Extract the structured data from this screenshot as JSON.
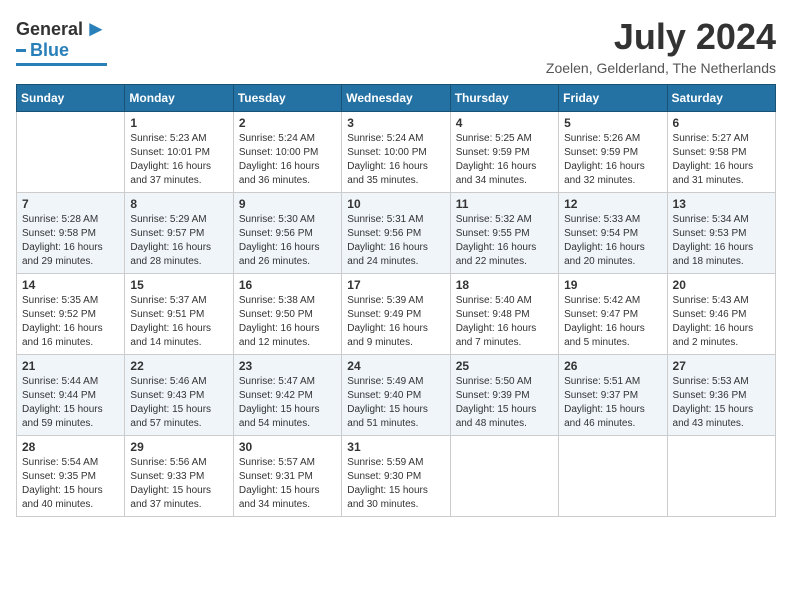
{
  "logo": {
    "general": "General",
    "blue": "Blue",
    "tagline": ""
  },
  "title": "July 2024",
  "location": "Zoelen, Gelderland, The Netherlands",
  "weekdays": [
    "Sunday",
    "Monday",
    "Tuesday",
    "Wednesday",
    "Thursday",
    "Friday",
    "Saturday"
  ],
  "weeks": [
    [
      {
        "day": "",
        "sunrise": "",
        "sunset": "",
        "daylight": ""
      },
      {
        "day": "1",
        "sunrise": "Sunrise: 5:23 AM",
        "sunset": "Sunset: 10:01 PM",
        "daylight": "Daylight: 16 hours and 37 minutes."
      },
      {
        "day": "2",
        "sunrise": "Sunrise: 5:24 AM",
        "sunset": "Sunset: 10:00 PM",
        "daylight": "Daylight: 16 hours and 36 minutes."
      },
      {
        "day": "3",
        "sunrise": "Sunrise: 5:24 AM",
        "sunset": "Sunset: 10:00 PM",
        "daylight": "Daylight: 16 hours and 35 minutes."
      },
      {
        "day": "4",
        "sunrise": "Sunrise: 5:25 AM",
        "sunset": "Sunset: 9:59 PM",
        "daylight": "Daylight: 16 hours and 34 minutes."
      },
      {
        "day": "5",
        "sunrise": "Sunrise: 5:26 AM",
        "sunset": "Sunset: 9:59 PM",
        "daylight": "Daylight: 16 hours and 32 minutes."
      },
      {
        "day": "6",
        "sunrise": "Sunrise: 5:27 AM",
        "sunset": "Sunset: 9:58 PM",
        "daylight": "Daylight: 16 hours and 31 minutes."
      }
    ],
    [
      {
        "day": "7",
        "sunrise": "Sunrise: 5:28 AM",
        "sunset": "Sunset: 9:58 PM",
        "daylight": "Daylight: 16 hours and 29 minutes."
      },
      {
        "day": "8",
        "sunrise": "Sunrise: 5:29 AM",
        "sunset": "Sunset: 9:57 PM",
        "daylight": "Daylight: 16 hours and 28 minutes."
      },
      {
        "day": "9",
        "sunrise": "Sunrise: 5:30 AM",
        "sunset": "Sunset: 9:56 PM",
        "daylight": "Daylight: 16 hours and 26 minutes."
      },
      {
        "day": "10",
        "sunrise": "Sunrise: 5:31 AM",
        "sunset": "Sunset: 9:56 PM",
        "daylight": "Daylight: 16 hours and 24 minutes."
      },
      {
        "day": "11",
        "sunrise": "Sunrise: 5:32 AM",
        "sunset": "Sunset: 9:55 PM",
        "daylight": "Daylight: 16 hours and 22 minutes."
      },
      {
        "day": "12",
        "sunrise": "Sunrise: 5:33 AM",
        "sunset": "Sunset: 9:54 PM",
        "daylight": "Daylight: 16 hours and 20 minutes."
      },
      {
        "day": "13",
        "sunrise": "Sunrise: 5:34 AM",
        "sunset": "Sunset: 9:53 PM",
        "daylight": "Daylight: 16 hours and 18 minutes."
      }
    ],
    [
      {
        "day": "14",
        "sunrise": "Sunrise: 5:35 AM",
        "sunset": "Sunset: 9:52 PM",
        "daylight": "Daylight: 16 hours and 16 minutes."
      },
      {
        "day": "15",
        "sunrise": "Sunrise: 5:37 AM",
        "sunset": "Sunset: 9:51 PM",
        "daylight": "Daylight: 16 hours and 14 minutes."
      },
      {
        "day": "16",
        "sunrise": "Sunrise: 5:38 AM",
        "sunset": "Sunset: 9:50 PM",
        "daylight": "Daylight: 16 hours and 12 minutes."
      },
      {
        "day": "17",
        "sunrise": "Sunrise: 5:39 AM",
        "sunset": "Sunset: 9:49 PM",
        "daylight": "Daylight: 16 hours and 9 minutes."
      },
      {
        "day": "18",
        "sunrise": "Sunrise: 5:40 AM",
        "sunset": "Sunset: 9:48 PM",
        "daylight": "Daylight: 16 hours and 7 minutes."
      },
      {
        "day": "19",
        "sunrise": "Sunrise: 5:42 AM",
        "sunset": "Sunset: 9:47 PM",
        "daylight": "Daylight: 16 hours and 5 minutes."
      },
      {
        "day": "20",
        "sunrise": "Sunrise: 5:43 AM",
        "sunset": "Sunset: 9:46 PM",
        "daylight": "Daylight: 16 hours and 2 minutes."
      }
    ],
    [
      {
        "day": "21",
        "sunrise": "Sunrise: 5:44 AM",
        "sunset": "Sunset: 9:44 PM",
        "daylight": "Daylight: 15 hours and 59 minutes."
      },
      {
        "day": "22",
        "sunrise": "Sunrise: 5:46 AM",
        "sunset": "Sunset: 9:43 PM",
        "daylight": "Daylight: 15 hours and 57 minutes."
      },
      {
        "day": "23",
        "sunrise": "Sunrise: 5:47 AM",
        "sunset": "Sunset: 9:42 PM",
        "daylight": "Daylight: 15 hours and 54 minutes."
      },
      {
        "day": "24",
        "sunrise": "Sunrise: 5:49 AM",
        "sunset": "Sunset: 9:40 PM",
        "daylight": "Daylight: 15 hours and 51 minutes."
      },
      {
        "day": "25",
        "sunrise": "Sunrise: 5:50 AM",
        "sunset": "Sunset: 9:39 PM",
        "daylight": "Daylight: 15 hours and 48 minutes."
      },
      {
        "day": "26",
        "sunrise": "Sunrise: 5:51 AM",
        "sunset": "Sunset: 9:37 PM",
        "daylight": "Daylight: 15 hours and 46 minutes."
      },
      {
        "day": "27",
        "sunrise": "Sunrise: 5:53 AM",
        "sunset": "Sunset: 9:36 PM",
        "daylight": "Daylight: 15 hours and 43 minutes."
      }
    ],
    [
      {
        "day": "28",
        "sunrise": "Sunrise: 5:54 AM",
        "sunset": "Sunset: 9:35 PM",
        "daylight": "Daylight: 15 hours and 40 minutes."
      },
      {
        "day": "29",
        "sunrise": "Sunrise: 5:56 AM",
        "sunset": "Sunset: 9:33 PM",
        "daylight": "Daylight: 15 hours and 37 minutes."
      },
      {
        "day": "30",
        "sunrise": "Sunrise: 5:57 AM",
        "sunset": "Sunset: 9:31 PM",
        "daylight": "Daylight: 15 hours and 34 minutes."
      },
      {
        "day": "31",
        "sunrise": "Sunrise: 5:59 AM",
        "sunset": "Sunset: 9:30 PM",
        "daylight": "Daylight: 15 hours and 30 minutes."
      },
      {
        "day": "",
        "sunrise": "",
        "sunset": "",
        "daylight": ""
      },
      {
        "day": "",
        "sunrise": "",
        "sunset": "",
        "daylight": ""
      },
      {
        "day": "",
        "sunrise": "",
        "sunset": "",
        "daylight": ""
      }
    ]
  ]
}
